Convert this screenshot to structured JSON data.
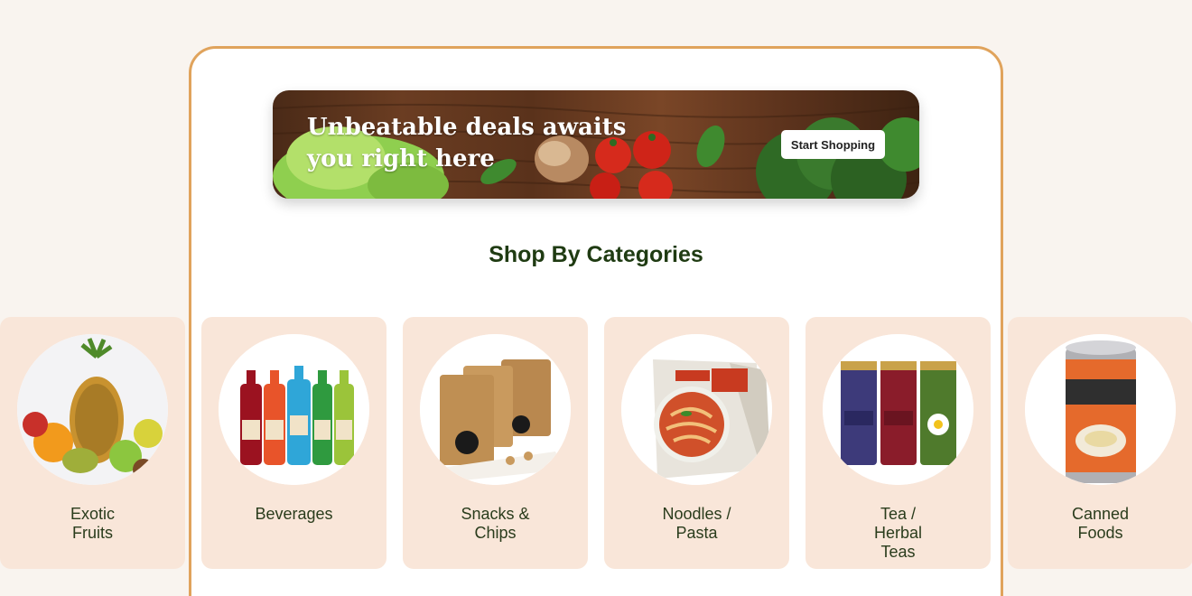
{
  "banner": {
    "headline": "Unbeatable deals awaits you right here",
    "cta_label": "Start Shopping"
  },
  "categories_section": {
    "title": "Shop By Categories",
    "items": [
      {
        "label": "Exotic Fruits",
        "icon": "fruits-image"
      },
      {
        "label": "Beverages",
        "icon": "bottles-image"
      },
      {
        "label": "Snacks & Chips",
        "icon": "snack-bags-image"
      },
      {
        "label": "Noodles / Pasta",
        "icon": "pasta-box-image"
      },
      {
        "label": "Tea / Herbal Teas",
        "icon": "tea-jars-image"
      },
      {
        "label": "Canned Foods",
        "icon": "tin-can-image"
      }
    ]
  },
  "colors": {
    "page_bg": "#f9f4ef",
    "frame_border": "#e0a35c",
    "card_bg": "#f9e6d9",
    "title_green": "#1f3b12"
  }
}
